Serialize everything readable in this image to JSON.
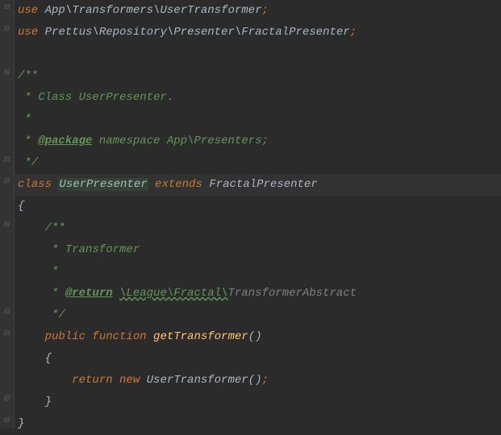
{
  "lines": {
    "l1_use": "use",
    "l1_ns": " App\\Transformers\\UserTransformer",
    "l1_semi": ";",
    "l2_use": "use",
    "l2_ns": " Prettus\\Repository\\Presenter\\FractalPresenter",
    "l2_semi": ";",
    "l3": "",
    "l4_doc": "/**",
    "l5_doc": " * Class UserPresenter.",
    "l6_doc": " *",
    "l7_star": " * ",
    "l7_tag": "@package",
    "l7_rest": " namespace App\\Presenters;",
    "l8_doc": " */",
    "l9_class": "class ",
    "l9_name": "UserPresenter",
    "l9_extends": " extends ",
    "l9_parent": "FractalPresenter",
    "l10_brace": "{",
    "l11_doc": "    /**",
    "l12_doc": "     * Transformer",
    "l13_doc": "     *",
    "l14_star": "     * ",
    "l14_tag": "@return",
    "l14_sp": " ",
    "l14_type": "\\League\\Fractal\\",
    "l14_type2": "TransformerAbstract",
    "l15_doc": "     */",
    "l16_pub": "    public ",
    "l16_fn": "function ",
    "l16_name": "getTransformer",
    "l16_paren": "()",
    "l17_brace": "    {",
    "l18_ret": "        return ",
    "l18_new": "new ",
    "l18_cls": "UserTransformer()",
    "l18_semi": ";",
    "l19_brace": "    }",
    "l20_brace": "}"
  }
}
